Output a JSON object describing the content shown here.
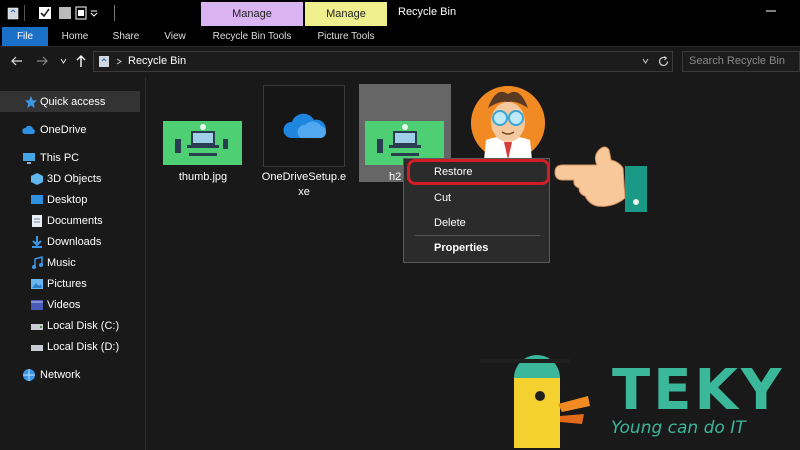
{
  "titlebar": {
    "manage_tab_1": "Manage",
    "manage_tab_2": "Manage",
    "window_title": "Recycle Bin",
    "manage_color_1": "#d9b3f2",
    "manage_color_2": "#f0ef8e"
  },
  "ribbon": {
    "tabs": [
      "File",
      "Home",
      "Share",
      "View",
      "Recycle Bin Tools",
      "Picture Tools"
    ],
    "file_color": "#1a6fc7"
  },
  "addressbar": {
    "path": "Recycle Bin",
    "search_placeholder": "Search Recycle Bin"
  },
  "navpane": {
    "items": [
      "Quick access",
      "OneDrive",
      "This PC",
      "3D Objects",
      "Desktop",
      "Documents",
      "Downloads",
      "Music",
      "Pictures",
      "Videos",
      "Local Disk (C:)",
      "Local Disk (D:)",
      "Network"
    ],
    "icons": [
      "star-icon",
      "cloud-icon",
      "computer-icon",
      "cube-icon",
      "desktop-icon",
      "documents-icon",
      "download-icon",
      "music-icon",
      "pictures-icon",
      "videos-icon",
      "drive-icon",
      "drive-icon",
      "network-icon"
    ]
  },
  "files": [
    {
      "name": "thumb.jpg",
      "icon": "image-thumbnail-icon"
    },
    {
      "name": "OneDriveSetup.exe",
      "label_line1": "OneDriveSetup.e",
      "label_line2": "xe",
      "icon": "onedrive-icon"
    },
    {
      "name_visible": "h2",
      "icon": "image-thumbnail-icon"
    }
  ],
  "context_menu": {
    "items": [
      "Restore",
      "Cut",
      "Delete",
      "Properties"
    ],
    "highlight_color": "#d11e26"
  },
  "logo": {
    "brand": "TEKY",
    "tagline": "Young can do IT",
    "brand_color": "#3bb79a",
    "mascot_color": "#f5d130"
  }
}
